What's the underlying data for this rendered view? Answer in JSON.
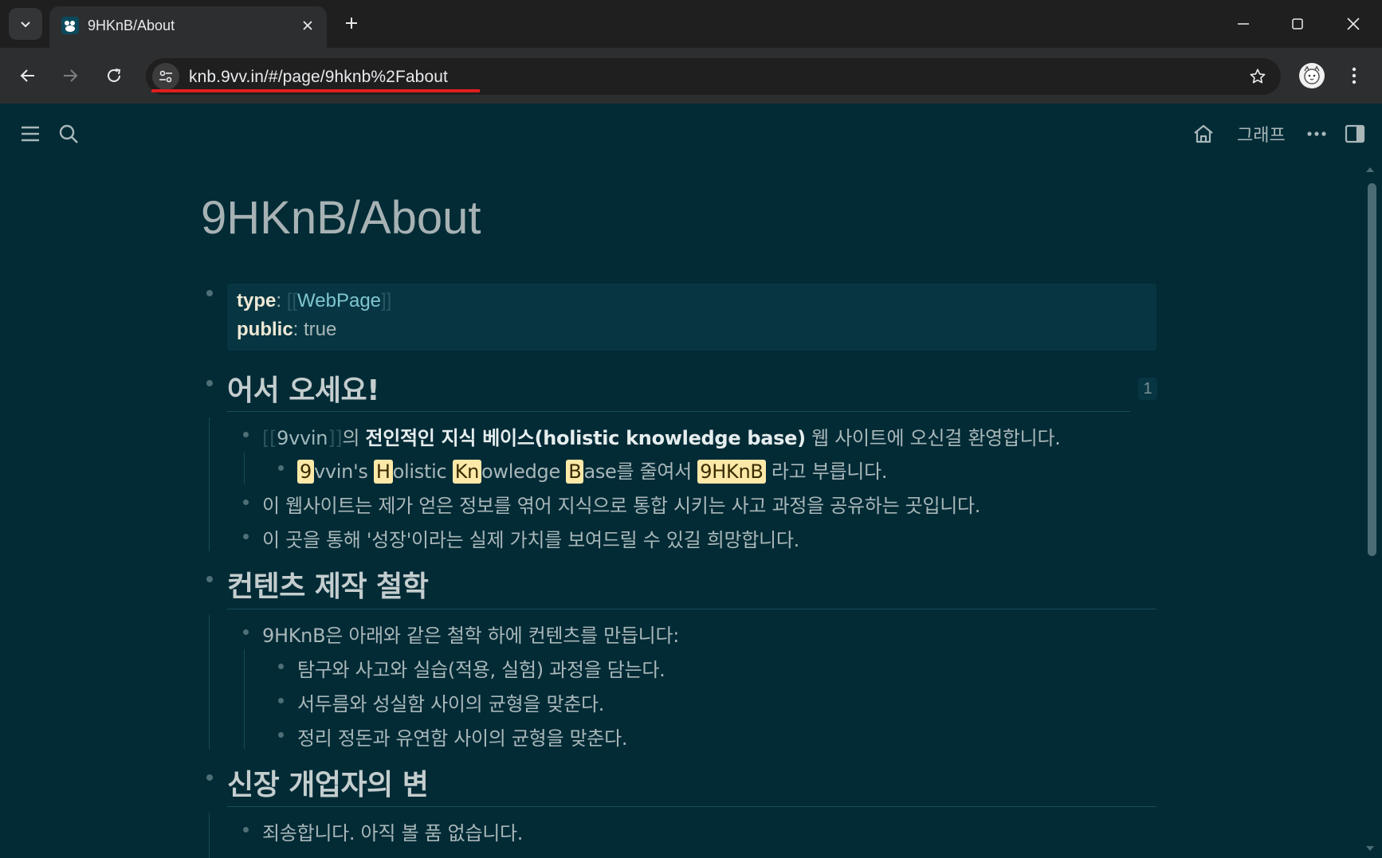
{
  "browser": {
    "tab_title": "9HKnB/About",
    "url": "knb.9vv.in/#/page/9hknb%2Fabout"
  },
  "app_header": {
    "graph_label": "그래프"
  },
  "page": {
    "title": "9HKnB/About",
    "properties": {
      "type_key": "type",
      "type_value": "WebPage",
      "public_key": "public",
      "public_value": "true"
    },
    "sections": [
      {
        "heading": "어서 오세요!",
        "ref_count": "1",
        "intro_link": "9vvin",
        "intro_mid": "의 ",
        "intro_bold": "전인적인 지식 베이스(holistic knowledge base)",
        "intro_tail": " 웹 사이트에 오신걸 환영합니다.",
        "acronym": {
          "h1": "9",
          "t1": "vvin's ",
          "h2": "H",
          "t2": "olistic ",
          "h3": "Kn",
          "t3": "owledge ",
          "h4": "B",
          "t4": "ase를 줄여서 ",
          "h5": "9HKnB",
          "t5": " 라고 부릅니다."
        },
        "line2": "이 웹사이트는 제가 얻은 정보를 엮어 지식으로 통합 시키는 사고 과정을 공유하는 곳입니다.",
        "line3": "이 곳을 통해 '성장'이라는 실제 가치를 보여드릴 수 있길 희망합니다."
      },
      {
        "heading": "컨텐츠 제작 철학",
        "line1": "9HKnB은 아래와 같은 철학 하에 컨텐츠를 만듭니다:",
        "sub": [
          "탐구와 사고와 실습(적용, 실험) 과정을 담는다.",
          "서두름와 성실함 사이의 균형을 맞춘다.",
          "정리 정돈과 유연함 사이의 균형을 맞춘다."
        ]
      },
      {
        "heading": "신장 개업자의 변",
        "line1": "죄송합니다. 아직 볼 품 없습니다."
      }
    ]
  }
}
